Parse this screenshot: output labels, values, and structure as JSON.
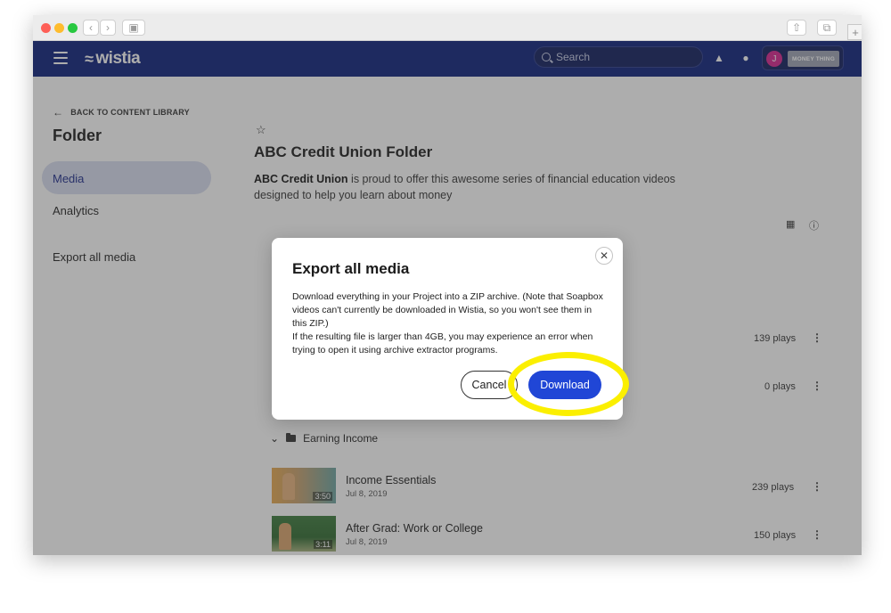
{
  "browser": {
    "new_tab_symbol": "+"
  },
  "navbar": {
    "logo_text": "wistia",
    "search_placeholder": "Search",
    "avatar_initial": "J",
    "account_logo_text": "MONEY THING"
  },
  "sidebar": {
    "back_label": "BACK TO CONTENT LIBRARY",
    "title": "Folder",
    "items": [
      {
        "label": "Media",
        "active": true
      },
      {
        "label": "Analytics",
        "active": false
      },
      {
        "label": "Export all media",
        "active": false
      }
    ]
  },
  "main": {
    "folder_title": "ABC Credit Union Folder",
    "description_bold": "ABC Credit Union",
    "description_rest": " is proud to offer this awesome series of financial education videos designed to help you learn about money",
    "rows_above": [
      {
        "plays": "139 plays"
      },
      {
        "plays": "0 plays"
      }
    ],
    "section_title": "Earning Income",
    "videos": [
      {
        "title": "Income Essentials",
        "date": "Jul 8, 2019",
        "duration": "3:50",
        "plays": "239 plays"
      },
      {
        "title": "After Grad: Work or College",
        "date": "Jul 8, 2019",
        "duration": "3:11",
        "plays": "150 plays"
      }
    ]
  },
  "modal": {
    "title": "Export all media",
    "body_line1": "Download everything in your Project into a ZIP archive. (Note that Soapbox videos can't currently be downloaded in Wistia, so you won't see them in this ZIP.)",
    "body_line2": "If the resulting file is larger than 4GB, you may experience an error when trying to open it using archive extractor programs.",
    "cancel_label": "Cancel",
    "download_label": "Download"
  },
  "colors": {
    "nav_bg": "#0a1e7a",
    "primary_button": "#2046d6",
    "highlight": "#fbef00"
  }
}
